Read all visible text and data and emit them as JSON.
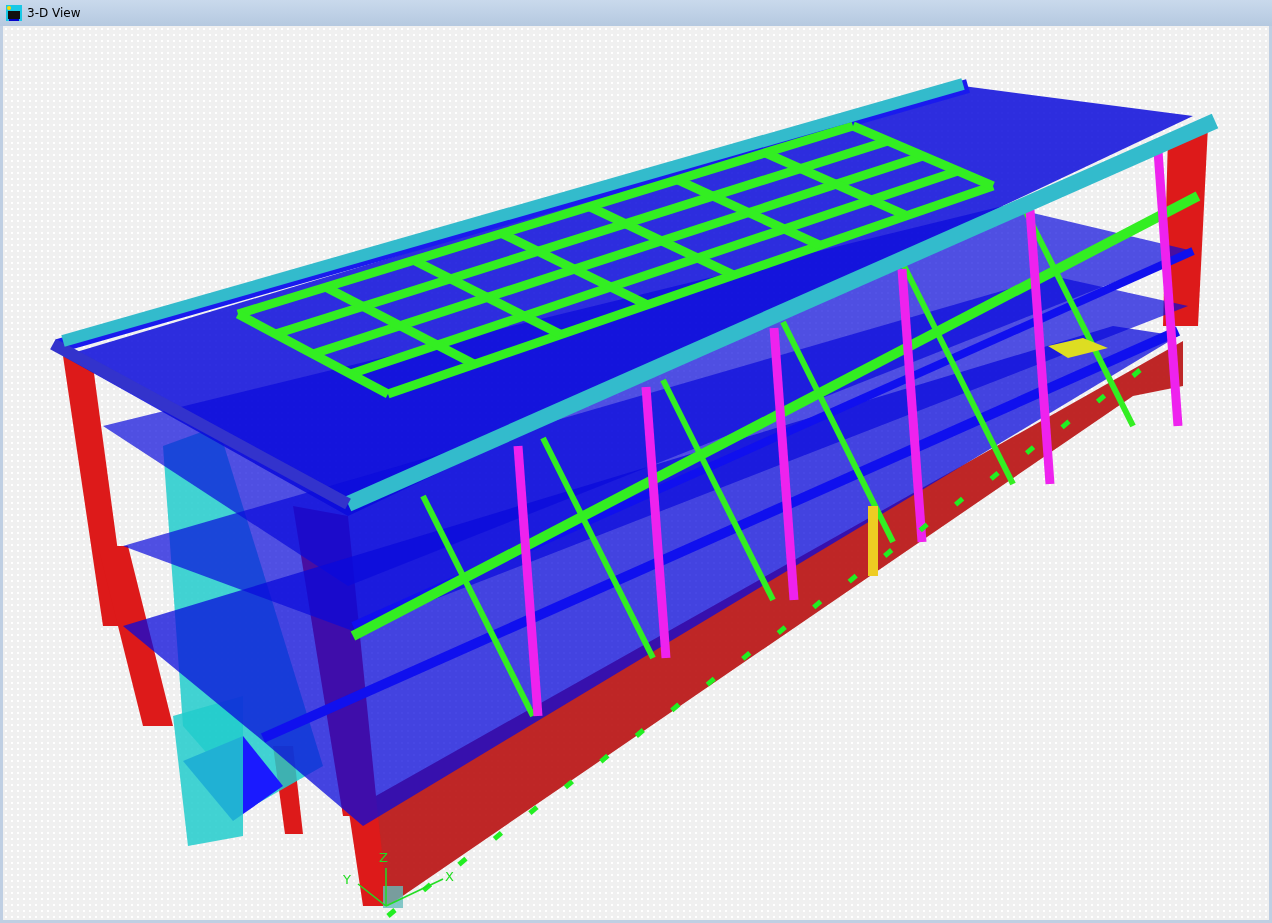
{
  "window": {
    "title": "3-D View"
  },
  "axes": {
    "labels": [
      {
        "kind": "z",
        "text": "Z"
      },
      {
        "kind": "y",
        "text": "Y"
      },
      {
        "kind": "x",
        "text": "X"
      }
    ]
  }
}
